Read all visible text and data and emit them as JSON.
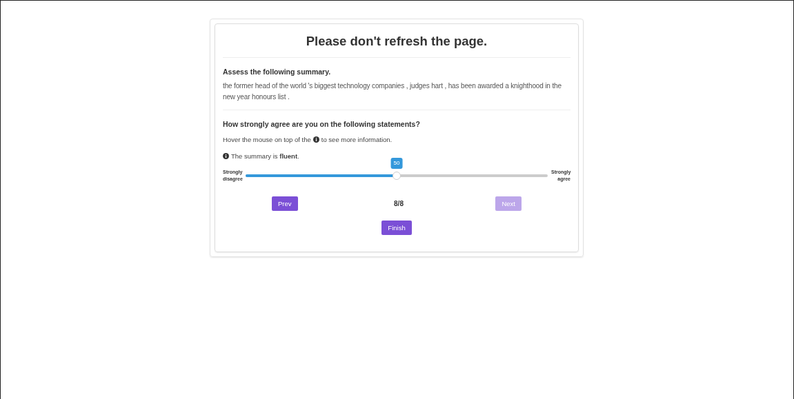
{
  "title": "Please don't refresh the page.",
  "summary": {
    "heading": "Assess the following summary.",
    "text": "the former head of the world 's biggest technology companies , judges hart , has been awarded a knighthood in the new year honours list ."
  },
  "question": {
    "heading": "How strongly agree are you on the following statements?",
    "hint_before": "Hover the mouse on top of the",
    "hint_after": "to see more information.",
    "statement": "The summary is **fluent**."
  },
  "slider": {
    "min_label": "Strongly disagree",
    "max_label": "Strongly agree",
    "value": "50",
    "level": 0.5
  },
  "nav": {
    "prev": {
      "label": "Prev",
      "disabled": false
    },
    "counter": "8/8",
    "next": {
      "label": "Next",
      "disabled": true
    }
  },
  "finish": {
    "label": "Finish",
    "disabled": false
  }
}
